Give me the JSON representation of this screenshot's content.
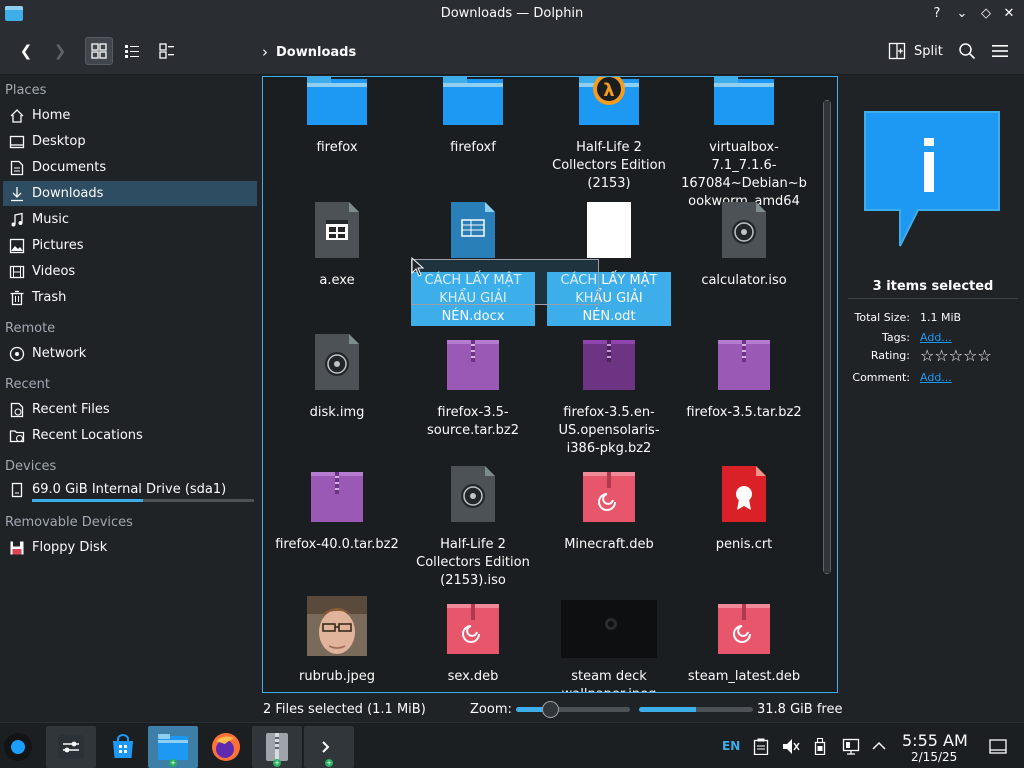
{
  "window": {
    "title": "Downloads — Dolphin",
    "help": "?",
    "minimize": "⌄",
    "maximize": "◇",
    "close": "✕"
  },
  "toolbar": {
    "back": "❮",
    "forward": "❯",
    "breadcrumb_sep": "›",
    "breadcrumb": "Downloads",
    "split": "Split"
  },
  "sidebar": {
    "sections": [
      {
        "title": "Places"
      },
      {
        "title": "Remote"
      },
      {
        "title": "Recent"
      },
      {
        "title": "Devices"
      },
      {
        "title": "Removable Devices"
      }
    ],
    "items": [
      {
        "label": "Home",
        "icon": "home-icon"
      },
      {
        "label": "Desktop",
        "icon": "desktop-icon"
      },
      {
        "label": "Documents",
        "icon": "documents-icon"
      },
      {
        "label": "Downloads",
        "icon": "downloads-icon"
      },
      {
        "label": "Music",
        "icon": "music-icon"
      },
      {
        "label": "Pictures",
        "icon": "pictures-icon"
      },
      {
        "label": "Videos",
        "icon": "videos-icon"
      },
      {
        "label": "Trash",
        "icon": "trash-icon"
      },
      {
        "label": "Network",
        "icon": "network-icon"
      },
      {
        "label": "Recent Files",
        "icon": "recent-files-icon"
      },
      {
        "label": "Recent Locations",
        "icon": "recent-locations-icon"
      },
      {
        "label": "69.0 GiB Internal Drive (sda1)",
        "icon": "drive-icon",
        "usage": 0.5
      },
      {
        "label": "Floppy Disk",
        "icon": "floppy-icon"
      }
    ]
  },
  "files": [
    {
      "name": "firefox",
      "type": "folder"
    },
    {
      "name": "firefoxf",
      "type": "folder"
    },
    {
      "name": "Half-Life 2 Collectors Edition (2153)",
      "type": "folder-hl"
    },
    {
      "name": "virtualbox-7.1_7.1.6-167084~Debian~bookworm_amd64",
      "type": "folder"
    },
    {
      "name": "a.exe",
      "type": "exe"
    },
    {
      "name": "CÁCH LẤY MẬT KHẨU GIẢI NÉN.docx",
      "type": "docx",
      "selected": true
    },
    {
      "name": "CÁCH LẤY MẬT KHẨU GIẢI NÉN.odt",
      "type": "odt",
      "selected": true
    },
    {
      "name": "calculator.iso",
      "type": "iso"
    },
    {
      "name": "disk.img",
      "type": "iso"
    },
    {
      "name": "firefox-3.5-source.tar.bz2",
      "type": "archive"
    },
    {
      "name": "firefox-3.5.en-US.opensolaris-i386-pkg.bz2",
      "type": "archive-dark"
    },
    {
      "name": "firefox-3.5.tar.bz2",
      "type": "archive"
    },
    {
      "name": "firefox-40.0.tar.bz2",
      "type": "archive"
    },
    {
      "name": "Half-Life 2 Collectors Edition (2153).iso",
      "type": "iso"
    },
    {
      "name": "Minecraft.deb",
      "type": "deb"
    },
    {
      "name": "penis.crt",
      "type": "crt"
    },
    {
      "name": "rubrub.jpeg",
      "type": "photo"
    },
    {
      "name": "sex.deb",
      "type": "deb"
    },
    {
      "name": "steam deck wallpaper.jpeg",
      "type": "wallpaper"
    },
    {
      "name": "steam_latest.deb",
      "type": "deb"
    }
  ],
  "info": {
    "count": "3 items selected",
    "size_key": "Total Size:",
    "size_val": "1.1 MiB",
    "tags_key": "Tags:",
    "tags_val": "Add...",
    "rating_key": "Rating:",
    "rating_val": "☆☆☆☆☆",
    "comment_key": "Comment:",
    "comment_val": "Add..."
  },
  "status": {
    "selection": "2 Files selected (1.1 MiB)",
    "zoom_label": "Zoom:",
    "zoom_level": 0.3,
    "free_fill": 0.5,
    "free": "31.8 GiB free"
  },
  "taskbar": {
    "lang": "EN",
    "time": "5:55 AM",
    "date": "2/15/25"
  }
}
